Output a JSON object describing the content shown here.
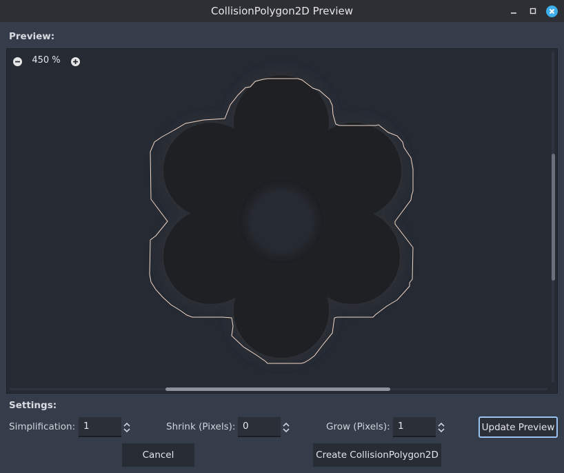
{
  "window": {
    "title": "CollisionPolygon2D Preview",
    "controls": [
      "minimize-icon",
      "maximize-icon",
      "close-icon"
    ],
    "accent": "#3daee9"
  },
  "preview": {
    "label": "Preview:",
    "zoom_label": "450 %",
    "icons": [
      "zoom-out-icon",
      "zoom-in-icon"
    ],
    "outline_color": "#f3d9c8",
    "flower_color": "#1f2024",
    "background": "#252a33"
  },
  "settings": {
    "label": "Settings:",
    "simplification": {
      "label": "Simplification:",
      "value": "1"
    },
    "shrink": {
      "label": "Shrink (Pixels):",
      "value": "0"
    },
    "grow": {
      "label": "Grow (Pixels):",
      "value": "1"
    }
  },
  "buttons": {
    "update_preview": "Update Preview",
    "cancel": "Cancel",
    "create": "Create CollisionPolygon2D"
  }
}
